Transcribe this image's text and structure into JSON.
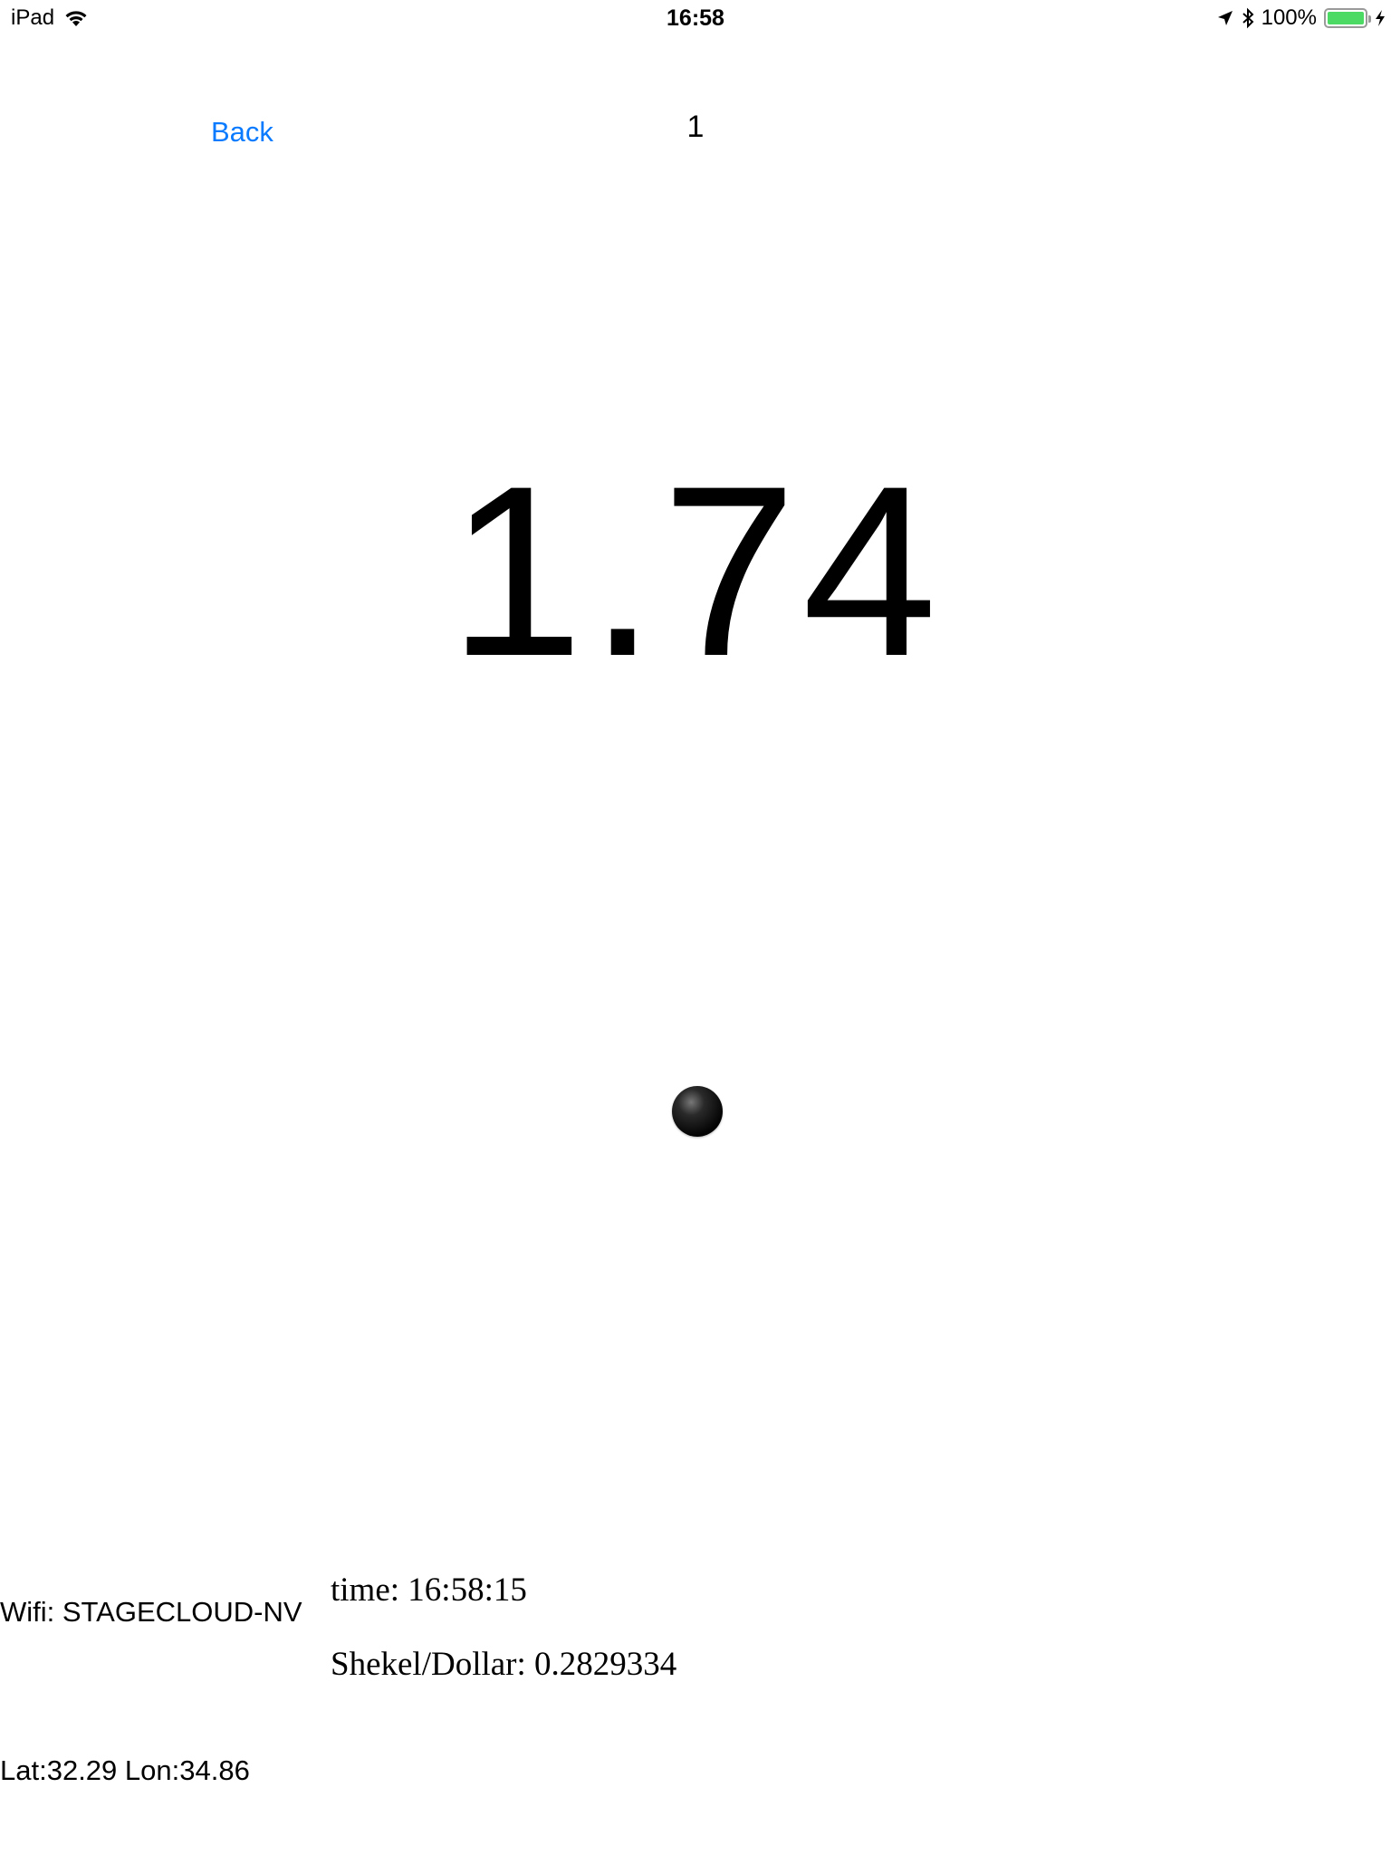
{
  "status_bar": {
    "device": "iPad",
    "time": "16:58",
    "battery": "100%",
    "battery_level": 1.0,
    "battery_color": "#4cd964",
    "icons": [
      "wifi-icon",
      "location-arrow-icon",
      "bluetooth-icon",
      "battery-icon",
      "charging-bolt-icon"
    ]
  },
  "nav": {
    "back_label": "Back",
    "back_color": "#0a7aff",
    "page_number": "1"
  },
  "main": {
    "value": "1.74"
  },
  "info": {
    "wifi": "Wifi: STAGECLOUD-NV",
    "time": "time: 16:58:15",
    "exchange_rate": "Shekel/Dollar: 0.2829334",
    "location": "Lat:32.29 Lon:34.86"
  }
}
